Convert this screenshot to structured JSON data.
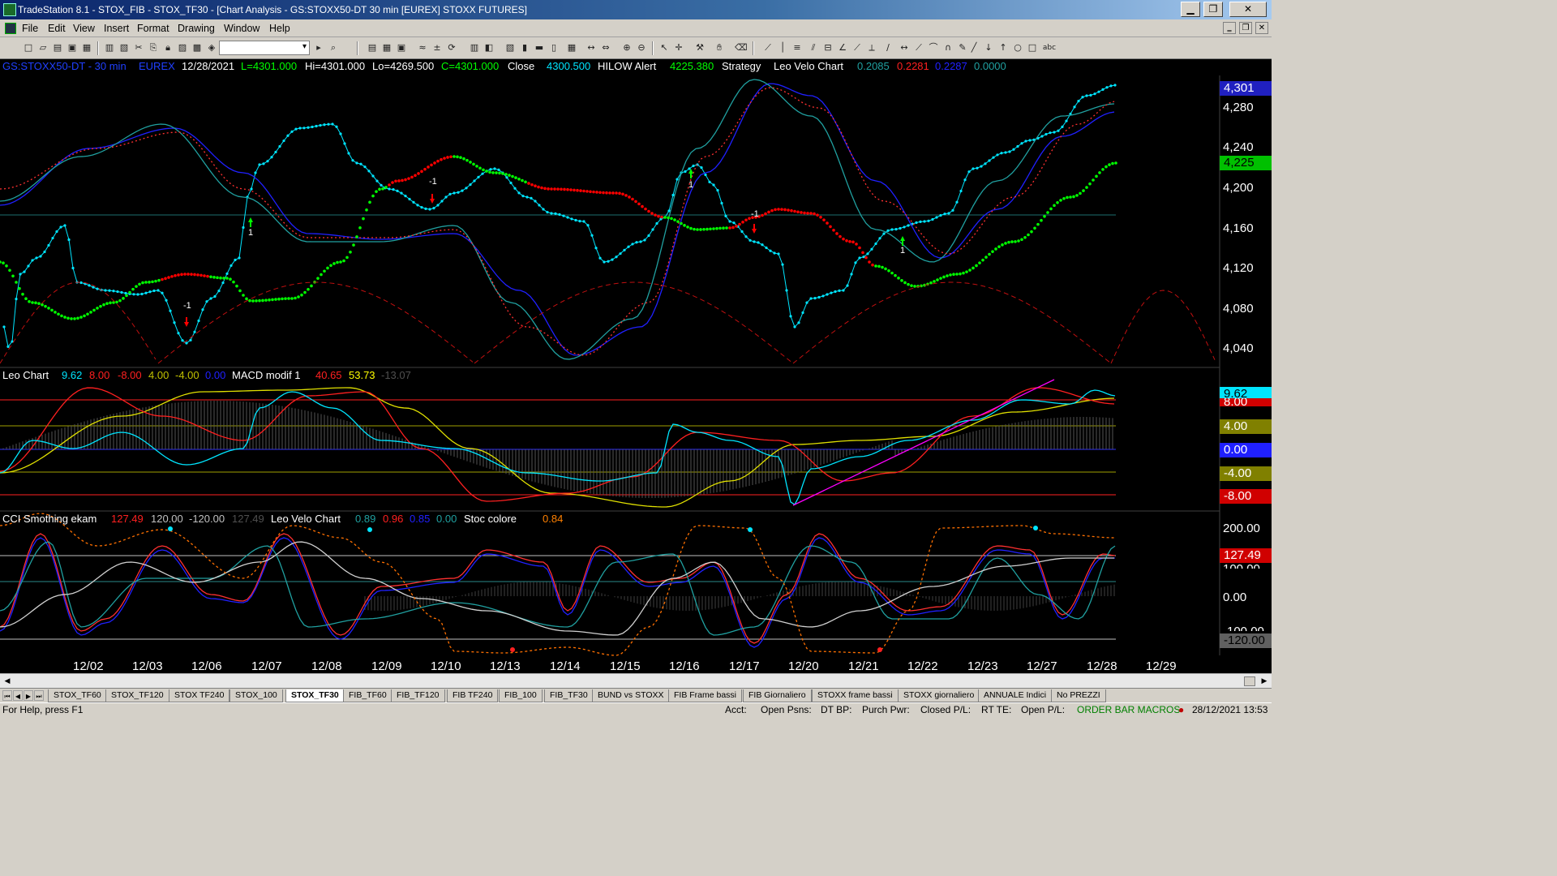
{
  "window": {
    "title": "TradeStation 8.1 - STOX_FIB - STOX_TF30 - [Chart Analysis - GS:STOXX50-DT  30 min  [EUREX] STOXX FUTURES]",
    "minimize": "▁",
    "restore": "❐",
    "close": "✕"
  },
  "menu": {
    "items": [
      "File",
      "Edit",
      "View",
      "Insert",
      "Format",
      "Drawing",
      "Window",
      "Help"
    ],
    "mdi_min": "‗",
    "mdi_restore": "❐",
    "mdi_close": "✕"
  },
  "toolbar": {
    "icons": [
      "new-doc-icon",
      "open-icon",
      "open2-icon",
      "save-icon",
      "print-icon",
      "print-preview-icon",
      "lock-icon",
      "cut-icon",
      "copy-icon",
      "paste-icon"
    ],
    "combo_arrow": "▾"
  },
  "chart": {
    "header1": {
      "symbol": "GS:STOXX50-DT - 30 min",
      "exchange": "EUREX",
      "date": "12/28/2021",
      "last": "L=4301.000",
      "high": "Hi=4301.000",
      "low": "Lo=4269.500",
      "close": "C=4301.000",
      "close_label": "Close",
      "close_value": "4300.500",
      "hilow": "HILOW Alert",
      "hilow_value": "4225.380",
      "strategy": "Strategy",
      "leo_velo": "Leo Velo Chart",
      "v1": "0.2085",
      "v2": "0.2281",
      "v3": "0.2287",
      "v4": "0.0000"
    },
    "header2": {
      "name": "Leo Chart",
      "v1": "9.62",
      "v2": "8.00",
      "v3": "-8.00",
      "v4": "4.00",
      "v5": "-4.00",
      "v6": "0.00",
      "macd": "MACD modif 1",
      "m1": "40.65",
      "m2": "53.73",
      "m3": "-13.07"
    },
    "header3": {
      "name": "CCI Smothing ekam",
      "v1": "127.49",
      "v2": "120.00",
      "v3": "-120.00",
      "v4": "127.49",
      "leo": "Leo Velo Chart",
      "l1": "0.89",
      "l2": "0.96",
      "l3": "0.85",
      "l4": "0.00",
      "stoc": "Stoc colore",
      "s1": "0.84"
    },
    "price_axis": [
      "4,301",
      "4,280",
      "4,240",
      "4,225",
      "4,200",
      "4,160",
      "4,120",
      "4,080",
      "4,040"
    ],
    "macd_axis": [
      "9.62",
      "8.00",
      "4.00",
      "0.00",
      "-4.00",
      "-8.00"
    ],
    "cci_axis": [
      "200.00",
      "127.49",
      "100.00",
      "0.00",
      "-100.00",
      "-120.00"
    ],
    "dates": [
      "12/02",
      "12/03",
      "12/06",
      "12/07",
      "12/08",
      "12/09",
      "12/10",
      "12/13",
      "12/14",
      "12/15",
      "12/16",
      "12/17",
      "12/20",
      "12/21",
      "12/22",
      "12/23",
      "12/27",
      "12/28",
      "12/29"
    ],
    "signals": [
      "-1",
      "1",
      "-1",
      "1",
      "-1",
      "1"
    ],
    "colors": {
      "price": "#00e5ff",
      "up": "#00ff00",
      "down": "#ff0000",
      "blue": "#2020ff",
      "teal": "#20a0a0",
      "yellow": "#ffff00",
      "magenta": "#ff00ff",
      "last_box": "#2020c0",
      "hilow_box": "#00c000"
    }
  },
  "tabs": [
    "STOX_TF60",
    "STOX_TF120",
    "STOX TF240",
    "STOX_100",
    "STOX_TF30",
    "FIB_TF60",
    "FIB_TF120",
    "FIB TF240",
    "FIB_100",
    "FIB_TF30",
    "BUND vs STOXX",
    "FIB Frame bassi",
    "FIB Giornaliero",
    "STOXX frame bassi",
    "STOXX giornaliero",
    "ANNUALE Indici",
    "No PREZZI"
  ],
  "status": {
    "help": "For Help, press F1",
    "acct": "Acct:",
    "open_psns": "Open Psns:",
    "dt_bp": "DT BP:",
    "purch_pwr": "Purch Pwr:",
    "closed_pl": "Closed P/L:",
    "rt_te": "RT TE:",
    "open_pl": "Open P/L:",
    "order_bar": "ORDER BAR  MACROS",
    "datetime": "28/12/2021 13:53"
  }
}
